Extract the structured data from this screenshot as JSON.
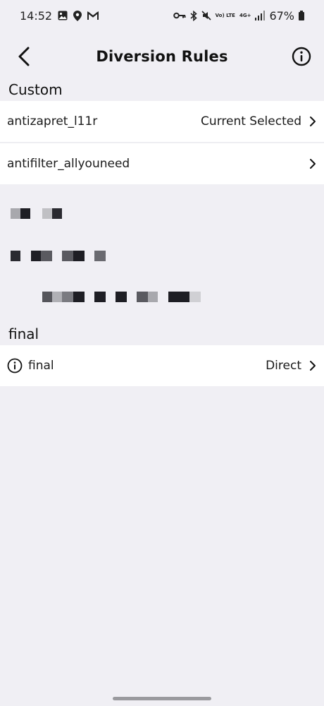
{
  "status_bar": {
    "time": "14:52",
    "network_top": "4G+",
    "network_volte": "Vo) LTE",
    "battery": "67%"
  },
  "header": {
    "title": "Diversion Rules"
  },
  "sections": {
    "custom_label": "Custom",
    "final_label": "final"
  },
  "custom_items": [
    {
      "title": "antizapret_l11r",
      "value": "Current Selected"
    },
    {
      "title": "antifilter_allyouneed",
      "value": ""
    }
  ],
  "final_item": {
    "title": "final",
    "value": "Direct"
  },
  "colors": {
    "background": "#f0eff4",
    "row_background": "#ffffff",
    "text": "#1a1a1a"
  }
}
